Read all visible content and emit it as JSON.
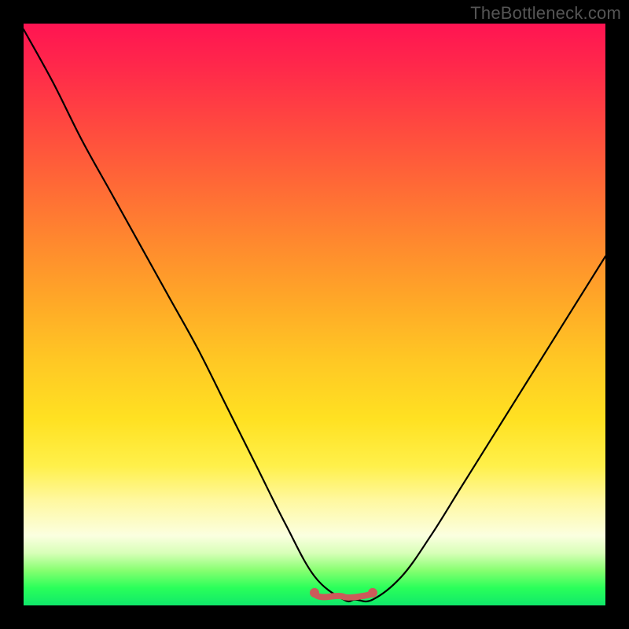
{
  "watermark": "TheBottleneck.com",
  "chart_data": {
    "type": "line",
    "title": "",
    "xlabel": "",
    "ylabel": "",
    "xlim": [
      0,
      100
    ],
    "ylim": [
      0,
      100
    ],
    "grid": false,
    "legend": false,
    "series": [
      {
        "name": "bottleneck-curve",
        "color": "#000000",
        "x": [
          0,
          5,
          10,
          15,
          20,
          25,
          30,
          35,
          40,
          45,
          50,
          55,
          57,
          60,
          65,
          70,
          75,
          80,
          85,
          90,
          95,
          100
        ],
        "values": [
          99,
          90,
          80,
          71,
          62,
          53,
          44,
          34,
          24,
          14,
          5,
          1,
          1,
          1,
          5,
          12,
          20,
          28,
          36,
          44,
          52,
          60
        ]
      }
    ],
    "highlight": {
      "name": "optimal-range",
      "color": "#cc5a5a",
      "x_start": 50,
      "x_end": 60,
      "y": 1.5
    }
  }
}
